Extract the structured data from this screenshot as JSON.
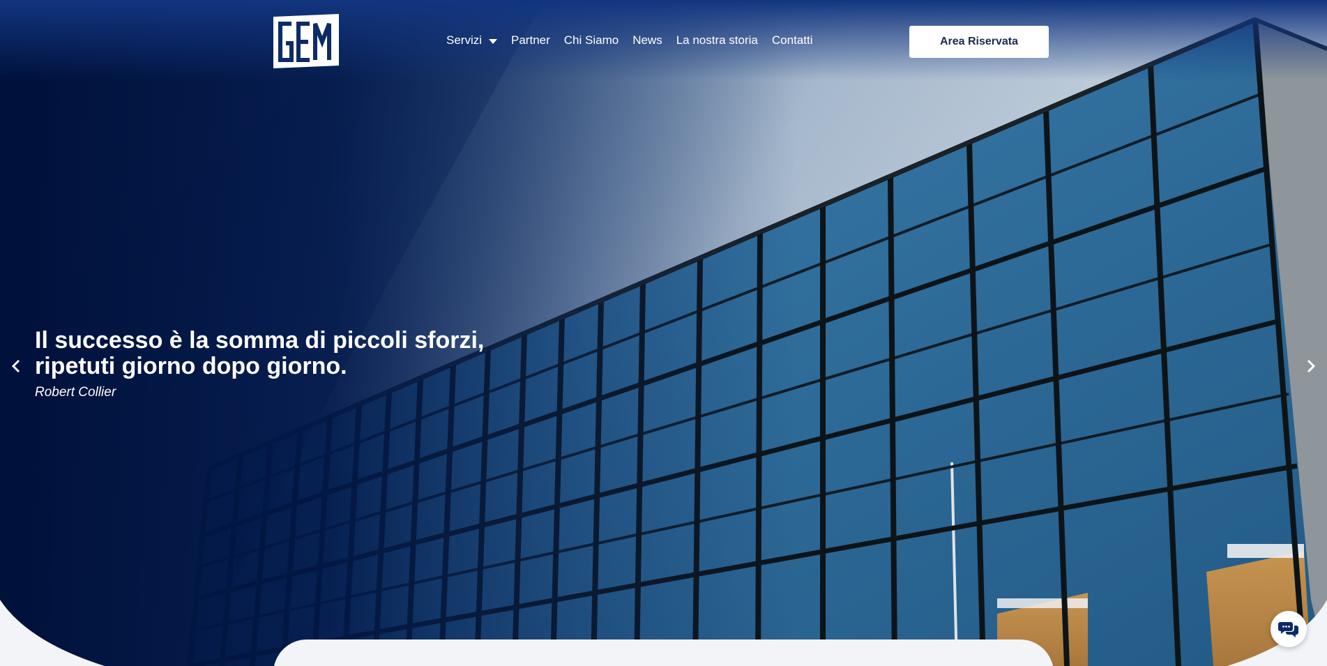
{
  "header": {
    "logo_text": "GEM",
    "nav": [
      {
        "label": "Servizi",
        "has_dropdown": true
      },
      {
        "label": "Partner"
      },
      {
        "label": "Chi Siamo"
      },
      {
        "label": "News"
      },
      {
        "label": "La nostra storia"
      },
      {
        "label": "Contatti"
      }
    ],
    "cta_label": "Area Riservata"
  },
  "hero": {
    "quote_line1": "Il successo è la somma di piccoli sforzi,",
    "quote_line2": "ripetuti giorno dopo giorno.",
    "author": "Robert Collier"
  },
  "icons": {
    "prev": "chevron-left-icon",
    "next": "chevron-right-icon",
    "dropdown": "caret-down-icon",
    "chat": "chat-bubbles-icon"
  },
  "colors": {
    "brand_navy": "#0b2a66",
    "dark_navy": "#001033",
    "glass_blue": "#2e6f9e",
    "cta_text": "#1b2a4e",
    "page_bg": "#f2f4f7"
  }
}
